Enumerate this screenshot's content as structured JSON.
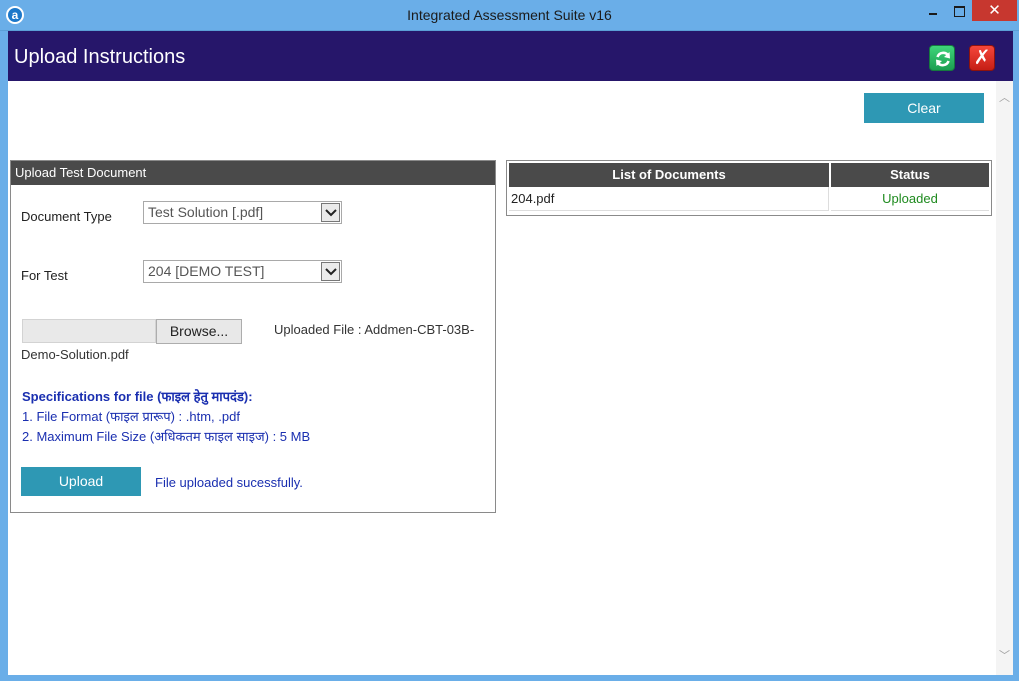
{
  "window": {
    "title": "Integrated Assessment Suite v16",
    "app_icon_letter": "a",
    "close_glyph": "✕"
  },
  "header": {
    "title": "Upload Instructions",
    "refresh_icon": "refresh-icon",
    "close_icon": "close-icon",
    "close_glyph": "✗"
  },
  "toolbar": {
    "clear_label": "Clear"
  },
  "upload_panel": {
    "heading": "Upload Test Document",
    "document_type_label": "Document Type",
    "document_type_value": "Test Solution [.pdf]",
    "for_test_label": "For Test",
    "for_test_value": "204 [DEMO TEST]",
    "browse_label": "Browse...",
    "uploaded_file_line1": "Uploaded File : Addmen-CBT-03B-",
    "uploaded_file_line2": "Demo-Solution.pdf",
    "spec_title": "Specifications for file (फाइल हेतु मापदंड):",
    "spec_items": [
      "1. File Format (फाइल प्रारूप) : .htm, .pdf",
      "2. Maximum File Size (अधिकतम फाइल साइज) : 5 MB"
    ],
    "upload_label": "Upload",
    "status_message": "File uploaded sucessfully."
  },
  "documents": {
    "columns": [
      "List of Documents",
      "Status"
    ],
    "rows": [
      {
        "document": "204.pdf",
        "status": "Uploaded"
      }
    ]
  },
  "colors": {
    "header_bg": "#26166a",
    "accent_button": "#2e98b4",
    "titlebar": "#6aaee8",
    "status_uploaded": "#1e8a1e",
    "spec_text": "#1a2fb0"
  }
}
